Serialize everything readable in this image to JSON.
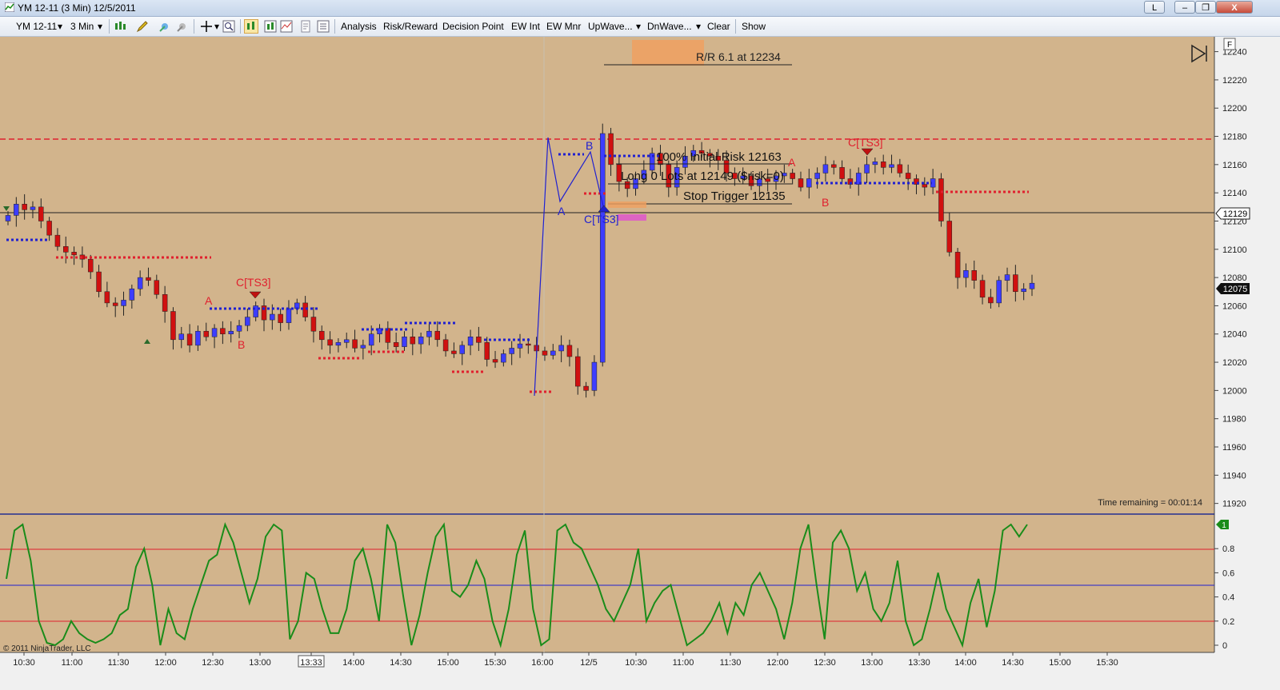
{
  "window": {
    "title": "YM 12-11 (3 Min)  12/5/2011",
    "minimize_label": "L",
    "close_label": "X"
  },
  "toolbar": {
    "instrument": "YM 12-11",
    "interval": "3 Min",
    "menus": [
      "Analysis",
      "Risk/Reward",
      "Decision Point",
      "EW Int",
      "EW Mnr",
      "UpWave...",
      "DnWave...",
      "Clear",
      "Show"
    ],
    "icons": [
      "bar-type-icon",
      "drawing-pencil-icon",
      "crosshair-icon",
      "global-crosshair-icon",
      "zoom-icon",
      "chart-style-icon",
      "properties-icon",
      "data-box-icon",
      "strategy-icon",
      "indicator-icon"
    ]
  },
  "price_axis": {
    "labels": [
      "12240",
      "12220",
      "12200",
      "12180",
      "12160",
      "12140",
      "12120",
      "12100",
      "12080",
      "12060",
      "12040",
      "12020",
      "12000",
      "11980",
      "11960",
      "11940",
      "11920"
    ],
    "marker_12129": "12129",
    "marker_last": "12075",
    "f_button": "F"
  },
  "osc_axis": {
    "labels": [
      "0.8",
      "0.6",
      "0.4",
      "0.2",
      "0"
    ],
    "current_badge": "1"
  },
  "time_axis": {
    "labels": [
      "10:30",
      "11:00",
      "11:30",
      "12:00",
      "12:30",
      "13:00",
      "13:33",
      "14:00",
      "14:30",
      "15:00",
      "15:30",
      "16:00",
      "12/5",
      "10:30",
      "11:00",
      "11:30",
      "12:00",
      "12:30",
      "13:00",
      "13:30",
      "14:00",
      "14:30",
      "15:00",
      "15:30"
    ]
  },
  "annotations": {
    "rr_label": "R/R 6.1 at 12234",
    "initial_risk": "100% Initial Risk 12163",
    "long_lots": "Long 0 Lots at 12149 ($risk=0)",
    "stop_trigger": "Stop Trigger 12135",
    "time_remaining": "Time remaining = 00:01:14",
    "copyright": "© 2011 NinjaTrader, LLC",
    "wave_a1": "A",
    "wave_b1": "B",
    "wave_c1": "C[TS3]",
    "wave_a2": "A",
    "wave_b2": "B",
    "wave_c2": "C[TS3]",
    "wave_a3": "A",
    "wave_b3": "B",
    "wave_c3": "C[TS3]"
  },
  "colors": {
    "chart_bg": "#d2b48c",
    "up_candle": "#3d3dff",
    "down_candle": "#d01010",
    "resistance": "#e0202e",
    "oscillator": "#1a8c1a",
    "wave_blue": "#2020d0"
  },
  "chart_data": [
    {
      "type": "candlestick",
      "title": "YM 12-11 (3 Min)",
      "ylim": [
        11913,
        12246
      ],
      "key_levels": {
        "resistance": 12182,
        "horizontal": 12129,
        "last": 12075
      },
      "closes_approx": [
        12124,
        12132,
        12128,
        12130,
        12120,
        12110,
        12102,
        12098,
        12096,
        12093,
        12084,
        12070,
        12062,
        12060,
        12064,
        12072,
        12080,
        12078,
        12068,
        12056,
        12036,
        12040,
        12032,
        12042,
        12038,
        12044,
        12040,
        12042,
        12046,
        12052,
        12060,
        12050,
        12054,
        12048,
        12058,
        12062,
        12052,
        12042,
        12036,
        12032,
        12034,
        12036,
        12030,
        12032,
        12040,
        12044,
        12034,
        12031,
        12038,
        12033,
        12038,
        12042,
        12036,
        12028,
        12026,
        12032,
        12038,
        12034,
        12022,
        12020,
        12026,
        12030,
        12033,
        12032,
        12028,
        12025,
        12028,
        12032,
        12024,
        12003,
        12000,
        12020,
        12182,
        12160,
        12148,
        12143,
        12150,
        12156,
        12168,
        12160,
        12144,
        12158,
        12166,
        12170,
        12168,
        12166,
        12163,
        12154,
        12150,
        12152,
        12145,
        12150,
        12148,
        12152,
        12154,
        12150,
        12144,
        12150,
        12154,
        12160,
        12158,
        12150,
        12146,
        12154,
        12160,
        12162,
        12158,
        12160,
        12154,
        12150,
        12146,
        12144,
        12150,
        12120,
        12098,
        12080,
        12085,
        12078,
        12066,
        12062,
        12078,
        12082,
        12070,
        12072,
        12076
      ],
      "oscillator": {
        "ylim": [
          0,
          1
        ],
        "levels": [
          0.8,
          0.5,
          0.2
        ],
        "values": [
          0.55,
          0.95,
          1.0,
          0.7,
          0.2,
          0.02,
          0.0,
          0.05,
          0.2,
          0.1,
          0.05,
          0.02,
          0.05,
          0.1,
          0.25,
          0.3,
          0.65,
          0.8,
          0.5,
          0.0,
          0.3,
          0.1,
          0.05,
          0.3,
          0.5,
          0.7,
          0.75,
          1.0,
          0.85,
          0.6,
          0.35,
          0.55,
          0.9,
          1.0,
          0.95,
          0.05,
          0.2,
          0.6,
          0.55,
          0.3,
          0.1,
          0.1,
          0.3,
          0.7,
          0.8,
          0.55,
          0.2,
          1.0,
          0.85,
          0.4,
          0.0,
          0.25,
          0.6,
          0.9,
          1.0,
          0.45,
          0.4,
          0.5,
          0.7,
          0.55,
          0.2,
          0.0,
          0.3,
          0.75,
          0.95,
          0.3,
          0.0,
          0.05,
          0.95,
          1.0,
          0.85,
          0.8,
          0.65,
          0.5,
          0.3,
          0.2,
          0.35,
          0.5,
          0.8,
          0.2,
          0.35,
          0.45,
          0.5,
          0.25,
          0.0,
          0.05,
          0.1,
          0.2,
          0.35,
          0.1,
          0.35,
          0.25,
          0.5,
          0.6,
          0.45,
          0.3,
          0.05,
          0.35,
          0.8,
          1.0,
          0.5,
          0.05,
          0.85,
          0.95,
          0.8,
          0.45,
          0.6,
          0.3,
          0.2,
          0.35,
          0.7,
          0.2,
          0.0,
          0.05,
          0.3,
          0.6,
          0.3,
          0.15,
          0.0,
          0.35,
          0.55,
          0.15,
          0.45,
          0.95,
          1.0,
          0.9,
          1.0
        ]
      }
    }
  ]
}
